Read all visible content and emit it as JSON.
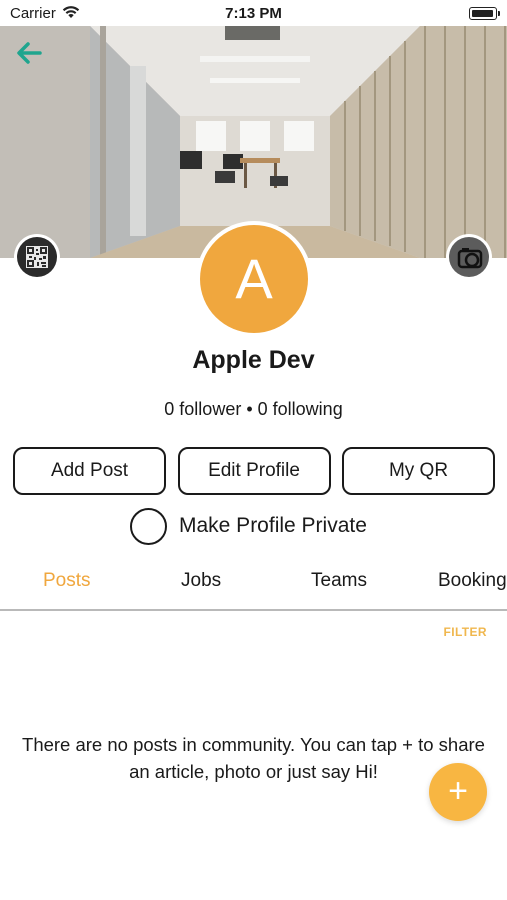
{
  "status_bar": {
    "carrier": "Carrier",
    "time": "7:13 PM"
  },
  "header": {
    "back_icon": "arrow-left-icon",
    "qr_icon": "qr-code-icon",
    "camera_icon": "camera-icon"
  },
  "profile": {
    "avatar_letter": "A",
    "avatar_color": "#f0a73e",
    "name": "Apple Dev",
    "followers": "0 follower",
    "following": "• 0 following"
  },
  "actions": {
    "add_post": "Add Post",
    "edit_profile": "Edit Profile",
    "my_qr": "My QR"
  },
  "privacy": {
    "label": "Make Profile Private",
    "checked": false
  },
  "tabs": [
    {
      "label": "Posts",
      "active": true
    },
    {
      "label": "Jobs",
      "active": false
    },
    {
      "label": "Teams",
      "active": false
    },
    {
      "label": "Booking",
      "active": false
    }
  ],
  "filter_label": "FILTER",
  "empty_message": "There are no posts in community. You can tap + to share an article, photo or just say Hi!",
  "fab_label": "+",
  "colors": {
    "accent": "#f0a73e",
    "back_arrow": "#1fa58e",
    "fab": "#f8b642"
  }
}
